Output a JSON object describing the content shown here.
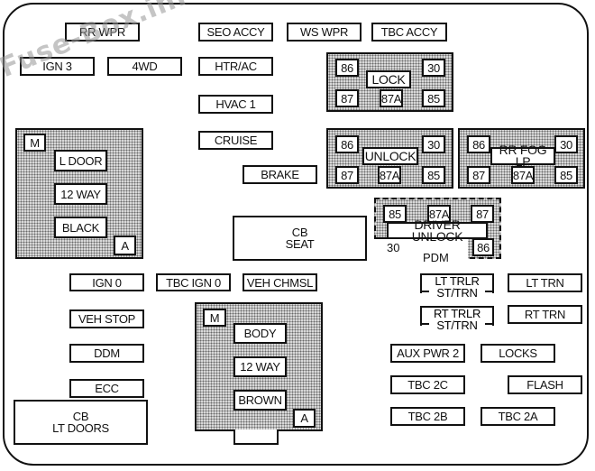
{
  "watermark": "Fuse-Box.info",
  "fuses": {
    "rr_wpr": "RR WPR",
    "seo_accy": "SEO ACCY",
    "ws_wpr": "WS WPR",
    "tbc_accy": "TBC ACCY",
    "ign3": "IGN 3",
    "fourwd": "4WD",
    "htr_ac": "HTR/AC",
    "hvac1": "HVAC 1",
    "cruise": "CRUISE",
    "brake": "BRAKE",
    "ign0": "IGN 0",
    "tbc_ign0": "TBC IGN 0",
    "veh_chmsl": "VEH CHMSL",
    "veh_stop": "VEH STOP",
    "ddm": "DDM",
    "ecc": "ECC",
    "lt_trlr_1": "LT TRLR",
    "lt_trlr_2": "ST/TRN",
    "lt_trn": "LT TRN",
    "rt_trlr_1": "RT TRLR",
    "rt_trlr_2": "ST/TRN",
    "rt_trn": "RT TRN",
    "aux_pwr2": "AUX PWR 2",
    "locks": "LOCKS",
    "tbc_2c": "TBC 2C",
    "flash": "FLASH",
    "tbc_2b": "TBC 2B",
    "tbc_2a": "TBC 2A"
  },
  "circuit_breakers": {
    "cb_seat_1": "CB",
    "cb_seat_2": "SEAT",
    "cb_lt_doors_1": "CB",
    "cb_lt_doors_2": "LT DOORS"
  },
  "relays": {
    "lock": {
      "name": "LOCK",
      "p86": "86",
      "p30": "30",
      "p87": "87",
      "p87a": "87A",
      "p85": "85"
    },
    "unlock": {
      "name": "UNLOCK",
      "p86": "86",
      "p30": "30",
      "p87": "87",
      "p87a": "87A",
      "p85": "85"
    },
    "rr_fog_lp": {
      "name": "RR FOG LP",
      "p86": "86",
      "p30": "30",
      "p87": "87",
      "p87a": "87A",
      "p85": "85"
    },
    "driver_unlock": {
      "name": "DRIVER UNLOCK",
      "p85": "85",
      "p87a": "87A",
      "p87": "87",
      "p30": "30",
      "p86": "86",
      "module": "PDM"
    }
  },
  "connectors": {
    "left": {
      "m": "M",
      "l1": "L DOOR",
      "l2": "12 WAY",
      "l3": "BLACK",
      "a": "A"
    },
    "bottom": {
      "m": "M",
      "l1": "BODY",
      "l2": "12 WAY",
      "l3": "BROWN",
      "a": "A"
    }
  }
}
